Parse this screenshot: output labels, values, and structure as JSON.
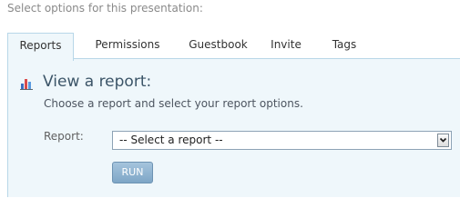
{
  "page": {
    "intro_text": "Select options for this presentation:"
  },
  "tabs": [
    {
      "label": "Reports",
      "active": true
    },
    {
      "label": "Permissions",
      "active": false
    },
    {
      "label": "Guestbook",
      "active": false
    },
    {
      "label": "Invite",
      "active": false
    },
    {
      "label": "Tags",
      "active": false
    }
  ],
  "report_panel": {
    "icon": "bar-chart-icon",
    "heading": "View a report:",
    "subheading": "Choose a report and select your report options.",
    "field_label": "Report:",
    "select_value": "-- Select a report --",
    "run_label": "RUN"
  },
  "colors": {
    "panel_background": "#eff7fb",
    "panel_border": "#b8d7e8",
    "heading_text": "#3c5568",
    "button_background": "#8fb1cf"
  }
}
